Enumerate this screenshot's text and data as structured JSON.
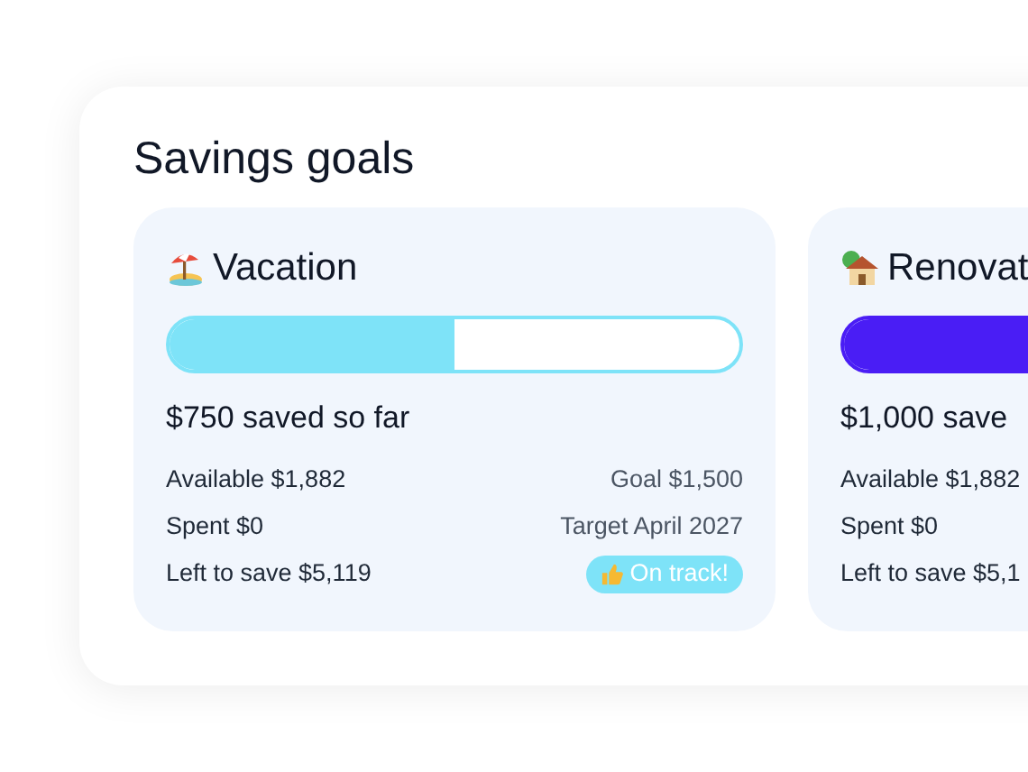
{
  "title": "Savings goals",
  "goals": [
    {
      "kind": "vacation",
      "name": "Vacation",
      "color": "#7ee3f8",
      "level": 0.5,
      "saved": "$750 saved so far",
      "available": "Available $1,882",
      "goal": "Goal $1,500",
      "spent": "Spent $0",
      "target": "Target April 2027",
      "left": "Left to save $5,119",
      "status": "On track!"
    },
    {
      "kind": "home",
      "name": "Renovat",
      "color": "#4a1df5",
      "level": 1,
      "saved": "$1,000 save",
      "available": "Available $1,882",
      "spent": "Spent $0",
      "left": "Left to save $5,1"
    }
  ]
}
